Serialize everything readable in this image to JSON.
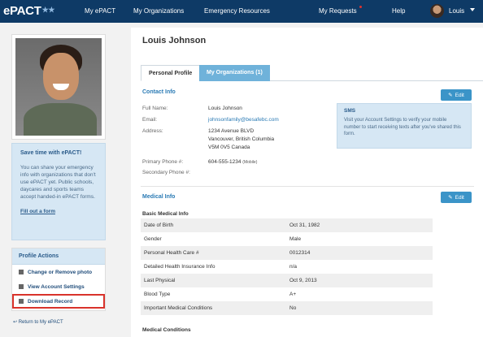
{
  "nav": {
    "logo": "ePACT",
    "logo_stars": "★★",
    "items": [
      "My ePACT",
      "My Organizations",
      "Emergency Resources",
      "My Requests",
      "Help"
    ],
    "user_name": "Louis",
    "notification_color": "#e0322f"
  },
  "sidebar": {
    "promo_title": "Save time with ePACT!",
    "promo_text": "You can share your emergency info with organizations that don't use ePACT yet. Public schools, daycares and sports teams accept handed-in ePACT forms.",
    "promo_link": "Fill out a form",
    "actions_title": "Profile Actions",
    "actions": [
      {
        "label": "Change or Remove photo",
        "icon": "photo-icon"
      },
      {
        "label": "View Account Settings",
        "icon": "settings-list-icon"
      },
      {
        "label": "Download Record",
        "icon": "printer-icon"
      }
    ],
    "return_link": "Return to My ePACT"
  },
  "profile": {
    "name": "Louis Johnson",
    "tabs": [
      "Personal Profile",
      "My Organizations (1)"
    ]
  },
  "contact": {
    "title": "Contact Info",
    "edit_label": "Edit",
    "full_name_label": "Full Name:",
    "full_name": "Louis Johnson",
    "email_label": "Email:",
    "email": "johnsonfamily@besafebc.com",
    "address_label": "Address:",
    "address_line1": "1234 Avenue BLVD",
    "address_line2": "Vancouver, British Columbia",
    "address_line3": "V5M 0V5 Canada",
    "primary_phone_label": "Primary Phone #:",
    "primary_phone": "604-555-1234",
    "primary_phone_type": "(Mobile)",
    "secondary_phone_label": "Secondary Phone #:",
    "sms_title": "SMS",
    "sms_text": "Visit your Account Settings to verify your mobile number to start receiving texts after you've shared this form."
  },
  "medical": {
    "title": "Medical Info",
    "edit_label": "Edit",
    "basic_title": "Basic Medical Info",
    "rows": [
      {
        "label": "Date of Birth",
        "value": "Oct 31, 1982"
      },
      {
        "label": "Gender",
        "value": "Male"
      },
      {
        "label": "Personal Health Care #",
        "value": "0012314"
      },
      {
        "label": "Detailed Health Insurance Info",
        "value": "n/a"
      },
      {
        "label": "Last Physical",
        "value": "Oct 9, 2013"
      },
      {
        "label": "Blood Type",
        "value": "A+"
      },
      {
        "label": "Important Medical Conditions",
        "value": "No"
      }
    ],
    "conditions_title": "Medical Conditions"
  }
}
